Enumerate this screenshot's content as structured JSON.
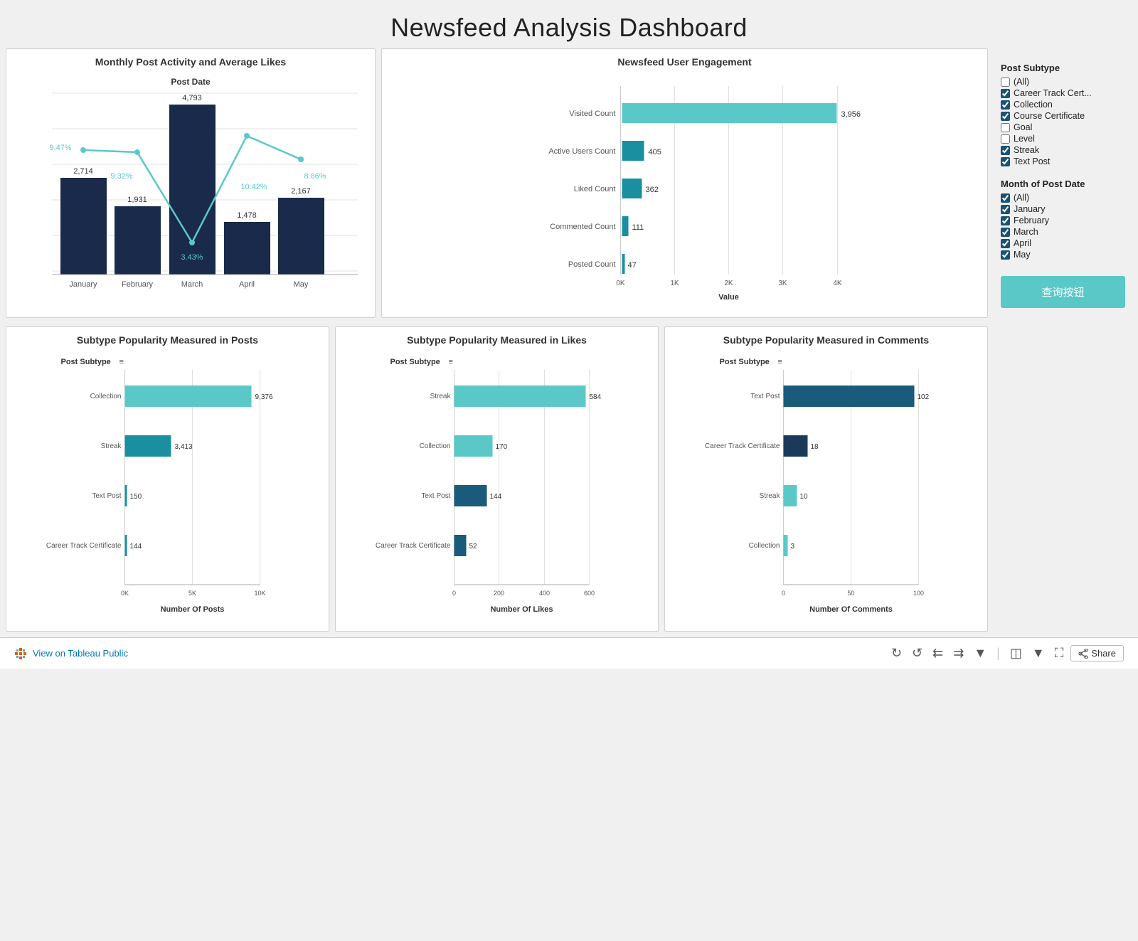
{
  "header": {
    "title": "Newsfeed Analysis Dashboard"
  },
  "sidebar": {
    "post_subtype_label": "Post Subtype",
    "filters_subtype": [
      {
        "label": "(All)",
        "checked": false
      },
      {
        "label": "Career Track Cert...",
        "checked": true
      },
      {
        "label": "Collection",
        "checked": true
      },
      {
        "label": "Course Certificate",
        "checked": true
      },
      {
        "label": "Goal",
        "checked": false
      },
      {
        "label": "Level",
        "checked": false
      },
      {
        "label": "Streak",
        "checked": true
      },
      {
        "label": "Text Post",
        "checked": true
      }
    ],
    "month_label": "Month of Post Date",
    "filters_month": [
      {
        "label": "(All)",
        "checked": true
      },
      {
        "label": "January",
        "checked": true
      },
      {
        "label": "February",
        "checked": true
      },
      {
        "label": "March",
        "checked": true
      },
      {
        "label": "April",
        "checked": true
      },
      {
        "label": "May",
        "checked": true
      }
    ],
    "query_btn": "查询按钮"
  },
  "monthly_chart": {
    "title": "Monthly Post Activity and Average Likes",
    "subtitle": "Post Date",
    "bars": [
      {
        "month": "January",
        "value": 2714,
        "pct": "9.47%"
      },
      {
        "month": "February",
        "value": 1931,
        "pct": "9.32%"
      },
      {
        "month": "March",
        "value": 4793,
        "pct": "3.43%"
      },
      {
        "month": "April",
        "value": 1478,
        "pct": "10.42%"
      },
      {
        "month": "May",
        "value": 2167,
        "pct": "8.86%"
      }
    ]
  },
  "engagement_chart": {
    "title": "Newsfeed User Engagement",
    "x_label": "Value",
    "rows": [
      {
        "label": "Visited Count",
        "value": 3956
      },
      {
        "label": "Active Users Count",
        "value": 405
      },
      {
        "label": "Liked Count",
        "value": 362
      },
      {
        "label": "Commented Count",
        "value": 111
      },
      {
        "label": "Posted Count",
        "value": 47
      }
    ],
    "x_ticks": [
      "0K",
      "1K",
      "2K",
      "3K",
      "4K"
    ]
  },
  "subtype_posts": {
    "title": "Subtype Popularity Measured in Posts",
    "axis_label": "Post Subtype",
    "x_label": "Number Of Posts",
    "x_ticks": [
      "0K",
      "5K",
      "10K"
    ],
    "bars": [
      {
        "label": "Collection",
        "value": 9376,
        "color": "#5bc8c8"
      },
      {
        "label": "Streak",
        "value": 3413,
        "color": "#1a8fa0"
      },
      {
        "label": "Text Post",
        "value": 150,
        "color": "#1a8fa0"
      },
      {
        "label": "Career Track Certificate",
        "value": 144,
        "color": "#1a8fa0"
      }
    ]
  },
  "subtype_likes": {
    "title": "Subtype Popularity Measured in Likes",
    "axis_label": "Post Subtype",
    "x_label": "Number Of Likes",
    "x_ticks": [
      "0",
      "200",
      "400",
      "600"
    ],
    "bars": [
      {
        "label": "Streak",
        "value": 584,
        "color": "#5bc8c8"
      },
      {
        "label": "Collection",
        "value": 170,
        "color": "#5bc8c8"
      },
      {
        "label": "Text Post",
        "value": 144,
        "color": "#1a5a7a"
      },
      {
        "label": "Career Track Certificate",
        "value": 52,
        "color": "#1a5a7a"
      }
    ]
  },
  "subtype_comments": {
    "title": "Subtype Popularity Measured in Comments",
    "axis_label": "Post Subtype",
    "x_label": "Number Of Comments",
    "x_ticks": [
      "0",
      "50",
      "100"
    ],
    "bars": [
      {
        "label": "Text Post",
        "value": 102,
        "color": "#1a5a7a"
      },
      {
        "label": "Career Track Certificate",
        "value": 18,
        "color": "#1a3a5a"
      },
      {
        "label": "Streak",
        "value": 10,
        "color": "#5bc8c8"
      },
      {
        "label": "Collection",
        "value": 3,
        "color": "#5bc8c8"
      }
    ]
  },
  "footer": {
    "tableau_label": "View on Tableau Public",
    "share_label": "Share"
  }
}
